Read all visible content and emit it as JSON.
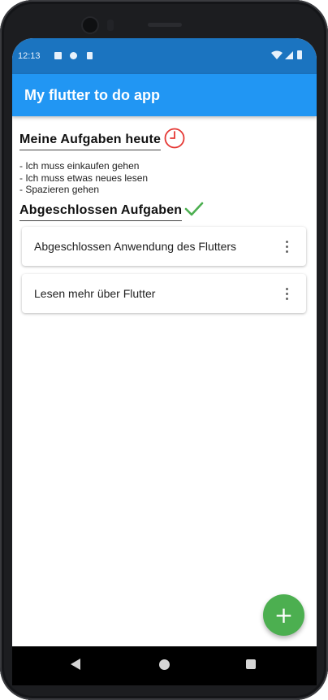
{
  "status_bar": {
    "time": "12:13",
    "left_icons": [
      "notification-a-icon",
      "vpn-icon",
      "sd-card-icon"
    ],
    "right_icons": [
      "wifi-icon",
      "signal-icon",
      "battery-icon"
    ]
  },
  "app_bar": {
    "title": "My flutter to do app"
  },
  "today": {
    "heading": "Meine Aufgaben heute",
    "icon": "clock-icon",
    "icon_color": "#e53935",
    "tasks": [
      "- Ich muss einkaufen gehen",
      "- Ich muss etwas neues lesen",
      "- Spazieren gehen"
    ]
  },
  "completed": {
    "heading": "Abgeschlossen Aufgaben",
    "icon": "checkmark-icon",
    "icon_color": "#4caf50",
    "items": [
      {
        "text": "Abgeschlossen Anwendung des Flutters"
      },
      {
        "text": "Lesen mehr über Flutter"
      }
    ]
  },
  "fab": {
    "label": "+",
    "color": "#4caf50"
  },
  "colors": {
    "status_bar": "#1b74c0",
    "app_bar": "#2196f3"
  }
}
